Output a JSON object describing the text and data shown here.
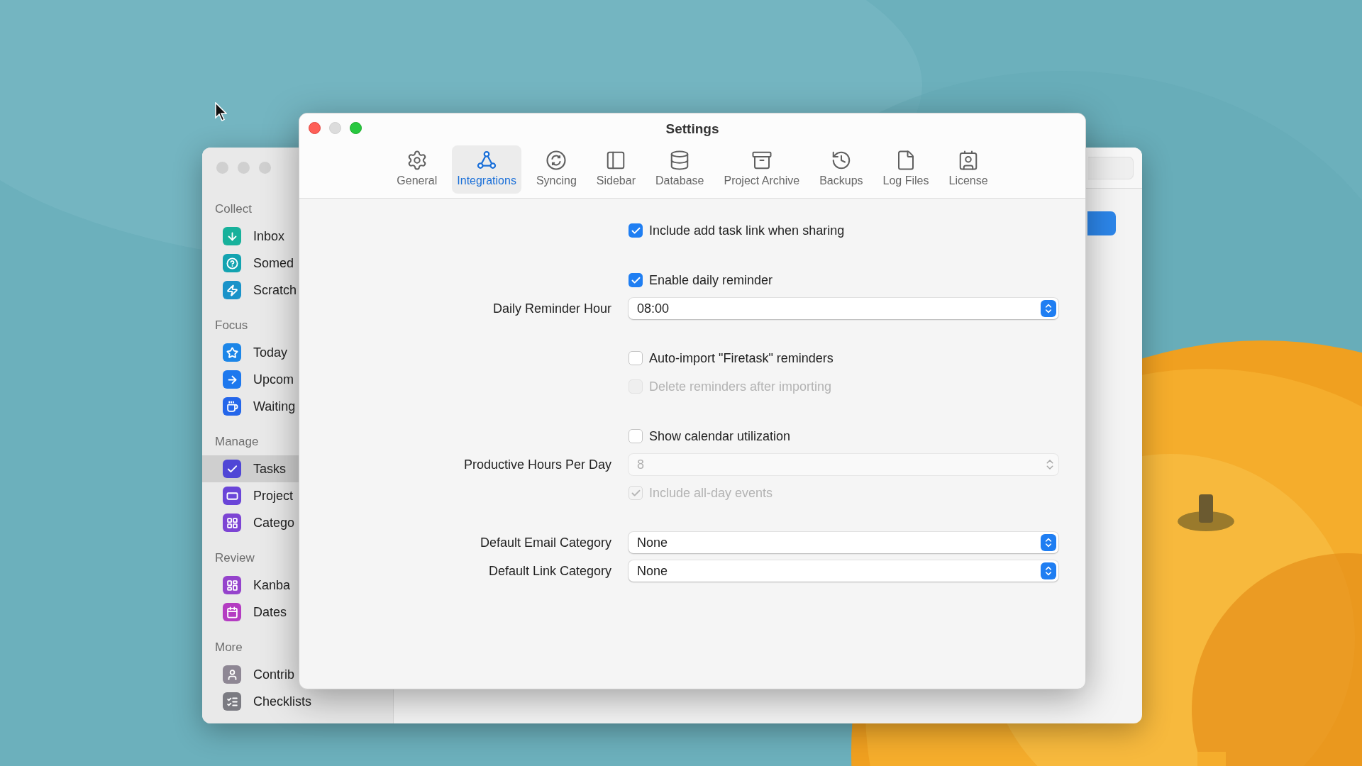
{
  "back_window": {
    "sidebar": [
      {
        "title": "Collect",
        "items": [
          {
            "label": "Inbox",
            "color": "#17b19b",
            "selected": false
          },
          {
            "label": "Somed",
            "color": "#13a3b0",
            "selected": false
          },
          {
            "label": "Scratch",
            "color": "#1a93c9",
            "selected": false
          }
        ]
      },
      {
        "title": "Focus",
        "items": [
          {
            "label": "Today",
            "color": "#1c86e8",
            "selected": false
          },
          {
            "label": "Upcom",
            "color": "#1d78ee",
            "selected": false
          },
          {
            "label": "Waiting",
            "color": "#2466ea",
            "selected": false
          }
        ]
      },
      {
        "title": "Manage",
        "items": [
          {
            "label": "Tasks",
            "color": "#5046d6",
            "selected": true
          },
          {
            "label": "Project",
            "color": "#6a45d8",
            "selected": false
          },
          {
            "label": "Catego",
            "color": "#7d45d4",
            "selected": false
          }
        ]
      },
      {
        "title": "Review",
        "items": [
          {
            "label": "Kanba",
            "color": "#9543cc",
            "selected": false
          },
          {
            "label": "Dates",
            "color": "#b43cc2",
            "selected": false
          }
        ]
      },
      {
        "title": "More",
        "items": [
          {
            "label": "Contrib",
            "color": "#8e8794",
            "selected": false
          },
          {
            "label": "Checklists",
            "color": "#7b7b82",
            "selected": false
          }
        ]
      }
    ]
  },
  "settings": {
    "title": "Settings",
    "tabs": [
      {
        "label": "General",
        "selected": false
      },
      {
        "label": "Integrations",
        "selected": true
      },
      {
        "label": "Syncing",
        "selected": false
      },
      {
        "label": "Sidebar",
        "selected": false
      },
      {
        "label": "Database",
        "selected": false
      },
      {
        "label": "Project Archive",
        "selected": false
      },
      {
        "label": "Backups",
        "selected": false
      },
      {
        "label": "Log Files",
        "selected": false
      },
      {
        "label": "License",
        "selected": false
      }
    ],
    "groups": [
      [
        {
          "kind": "checkbox",
          "label": "Include add task link when sharing",
          "checked": true,
          "disabled": false
        }
      ],
      [
        {
          "kind": "checkbox",
          "label": "Enable daily reminder",
          "checked": true,
          "disabled": false
        },
        {
          "kind": "popup",
          "label": "Daily Reminder Hour",
          "value": "08:00",
          "disabled": false
        }
      ],
      [
        {
          "kind": "checkbox",
          "label": "Auto-import \"Firetask\" reminders",
          "checked": false,
          "disabled": false
        },
        {
          "kind": "checkbox",
          "label": "Delete reminders after importing",
          "checked": false,
          "disabled": true
        }
      ],
      [
        {
          "kind": "checkbox",
          "label": "Show calendar utilization",
          "checked": false,
          "disabled": false
        },
        {
          "kind": "stepper",
          "label": "Productive Hours Per Day",
          "value": "8",
          "disabled": true
        },
        {
          "kind": "checkbox",
          "label": "Include all-day events",
          "checked": true,
          "disabled": true
        }
      ],
      [
        {
          "kind": "popup",
          "label": "Default Email Category",
          "value": "None",
          "disabled": false
        },
        {
          "kind": "popup",
          "label": "Default Link Category",
          "value": "None",
          "disabled": false
        }
      ]
    ]
  }
}
